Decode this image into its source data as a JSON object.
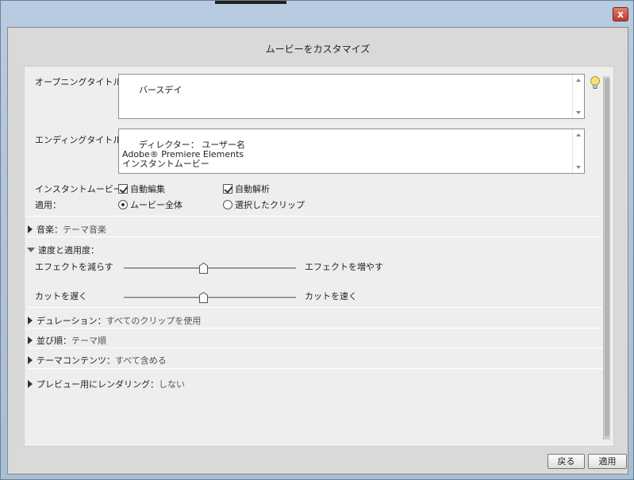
{
  "dialog": {
    "title": "ムービーをカスタマイズ"
  },
  "opening_title": {
    "label": "オープニングタイトル：",
    "value": "バースデイ"
  },
  "ending_title": {
    "label": "エンディングタイトル：",
    "value": "ディレクター： ユーザー名\nAdobe® Premiere Elements\nインスタントムービー"
  },
  "instant_movie": {
    "label": "インスタントムービー：",
    "auto_edit": {
      "label": "自動編集",
      "checked": true
    },
    "auto_analyze": {
      "label": "自動解析",
      "checked": true
    }
  },
  "apply_to": {
    "label": "適用：",
    "options": [
      {
        "label": "ムービー全体",
        "selected": true
      },
      {
        "label": "選択したクリップ",
        "selected": false
      }
    ]
  },
  "sections": {
    "music": {
      "label": "音楽",
      "value": "テーマ音楽"
    },
    "speed": {
      "label": "速度と適用度："
    },
    "duration": {
      "label": "デュレーション",
      "value": "すべてのクリップを使用"
    },
    "order": {
      "label": "並び順",
      "value": "テーマ順"
    },
    "theme_content": {
      "label": "テーマコンテンツ",
      "value": "すべて含める"
    },
    "preview_render": {
      "label": "プレビュー用にレンダリング",
      "value": "しない"
    }
  },
  "sliders": {
    "effects": {
      "min_label": "エフェクトを減らす",
      "max_label": "エフェクトを増やす",
      "value": 0.5
    },
    "cuts": {
      "min_label": "カットを遅く",
      "max_label": "カットを速く",
      "value": 0.5
    }
  },
  "colon": "：",
  "buttons": {
    "back": "戻る",
    "apply": "適用"
  },
  "window": {
    "close_glyph": "x"
  },
  "icons": {
    "tip": "lightbulb-icon",
    "close": "close-icon",
    "expand": "triangle-right-icon",
    "collapse": "triangle-down-icon"
  }
}
